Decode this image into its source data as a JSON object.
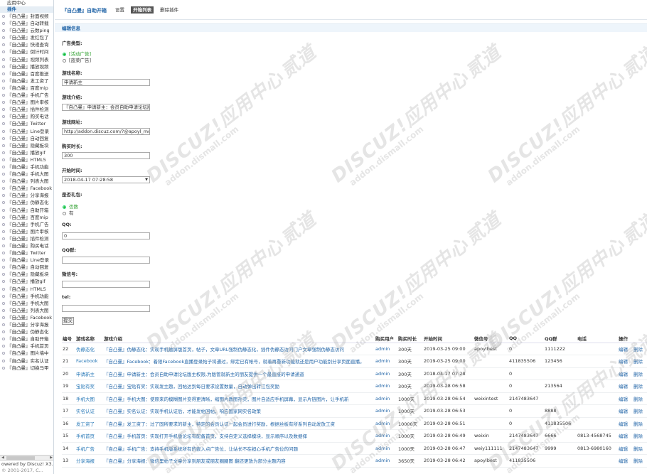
{
  "sidebar": {
    "top": "应用中心",
    "section": "插件",
    "items": [
      "『自凸曼』封面视频",
      "『自凸曼』自动转载",
      "『自凸曼』云数ping",
      "『自凸曼』发红包了",
      "『自凸曼』快递查询",
      "『自凸曼』倒计时间",
      "『自凸曼』视频列表",
      "『自凸曼』播放视频",
      "『自凸曼』百度推送",
      "『自凸曼』发工资了",
      "『自凸曼』百度mip",
      "『自凸曼』手机广告",
      "『自凸曼』图片审核",
      "『自凸曼』插件检测",
      "『自凸曼』购买电话",
      "『自凸曼』Twitter",
      "『自凸曼』Line登录",
      "『自凸曼』自动回复",
      "『自凸曼』隐藏板块",
      "『自凸曼』播放gif",
      "『自凸曼』HTML5",
      "『自凸曼』手机功能",
      "『自凸曼』手机大图",
      "『自凸曼』列表大图",
      "『自凸曼』Facebook",
      "『自凸曼』分享海报",
      "『自凸曼』伪静态化",
      "『自凸曼』自助开箱",
      "『自凸曼』百度mip",
      "『自凸曼』手机广告",
      "『自凸曼』图片审核",
      "『自凸曼』插件检测",
      "『自凸曼』购买电话",
      "『自凸曼』Twitter",
      "『自凸曼』Line登录",
      "『自凸曼』自动回复",
      "『自凸曼』隐藏板块",
      "『自凸曼』播放gif",
      "『自凸曼』HTML5",
      "『自凸曼』手机功能",
      "『自凸曼』手机大图",
      "『自凸曼』列表大图",
      "『自凸曼』Facebook",
      "『自凸曼』分享海报",
      "『自凸曼』伪静态化",
      "『自凸曼』自助开箱",
      "『自凸曼』手机首页",
      "『自凸曼』图片墙中",
      "『自凸曼』实名认证",
      "『自凸曼』切换马甲"
    ],
    "powered": "owered by Discuz! X3.4",
    "copyright": "© 2001-2017, C..."
  },
  "header": {
    "title": "『自凸曼』自助开箱",
    "tabs": [
      {
        "label": "设置",
        "active": false
      },
      {
        "label": "开箱列表",
        "active": true
      },
      {
        "label": "删除插件",
        "active": false
      }
    ]
  },
  "section_title": "编辑信息",
  "form": {
    "ad_type_label": "广告类型:",
    "ad_type_options": [
      {
        "label": "[活动广告]",
        "checked": true
      },
      {
        "label": "[蓝菜广告]",
        "checked": false
      }
    ],
    "name_label": "游戏名称:",
    "name_value": "申请新主",
    "intro_label": "游戏介绍:",
    "intro_value": "『自凸曼』申请新主：会员自助申请论坛版主栏",
    "url_label": "游戏网址:",
    "url_value": "http://addon.discuz.com/?@apoyl_moder",
    "duration_label": "购买时长:",
    "duration_value": "300",
    "start_label": "开始时间:",
    "start_value": "2018-04-17 07:28:58",
    "gift_label": "是否礼包:",
    "gift_options": [
      {
        "label": "否数",
        "checked": true
      },
      {
        "label": "有",
        "checked": false
      }
    ],
    "qq_label": "QQ:",
    "qq_value": "0",
    "qqgroup_label": "QQ群:",
    "qqgroup_value": "",
    "wechat_label": "微信号:",
    "wechat_value": "",
    "tel_label": "tel:",
    "tel_value": "",
    "submit_label": "提交"
  },
  "table": {
    "columns": [
      "编号",
      "游戏名称",
      "游戏介绍",
      "购买用户",
      "购买时长",
      "开始时间",
      "微信号",
      "QQ",
      "QQ群",
      "电话",
      "操作"
    ],
    "rows": [
      {
        "id": "22",
        "name": "伪静态化",
        "intro": "『自凸曼』伪静态化：实现手机触屏版首页，帖子，文章URL强制伪静态化，插件伪静态访问门户文章强制伪静态访问",
        "user": "admin",
        "dur": "300天",
        "start": "2019-03-25 09:00",
        "wx": "apoylbest",
        "qq": "0",
        "qqg": "1111222",
        "tel": "",
        "edit": "编辑",
        "del": "删除"
      },
      {
        "id": "21",
        "name": "Facebook",
        "intro": "『自凸曼』Facebook：着限Facebook直播登录帖子将通过，绑定已有帐号，就着再重新功能就还是用户功能别分享页面直播。",
        "user": "admin",
        "dur": "300天",
        "start": "2019-03-25 09:00",
        "wx": "",
        "qq": "411835506",
        "qqg": "123456",
        "tel": "",
        "edit": "编辑",
        "del": "删除"
      },
      {
        "id": "20",
        "name": "申请新主",
        "intro": "『自凸曼』申请新主：会员自助申请论坛版主权限,为版管就新主的朋友提供一个最直接的申请通道",
        "user": "admin",
        "dur": "300天",
        "start": "2018-04-17 07:28",
        "wx": "",
        "qq": "0",
        "qqg": "",
        "tel": "",
        "edit": "编辑",
        "del": "删除"
      },
      {
        "id": "19",
        "name": "宝贴有奖",
        "intro": "『自凸曼』宝贴有奖：实现发主题，回帖达到每日要求设置数量，自动弹出转江包奖励",
        "user": "admin",
        "dur": "300天",
        "start": "2019-03-28 06:58",
        "wx": "",
        "qq": "0",
        "qqg": "213564",
        "tel": "",
        "edit": "编辑",
        "del": "删除"
      },
      {
        "id": "18",
        "name": "手机大图",
        "intro": "『自凸曼』手机大图：使原来的模糊图片变得更清晰，缩图片教图孙荧，图片自适应手机屏幕，显示片链图片，让手机新",
        "user": "admin",
        "dur": "1000天",
        "start": "2019-03-28 06:54",
        "wx": "weixintest",
        "qq": "2147483647",
        "qqg": "",
        "tel": "",
        "edit": "编辑",
        "del": "删除"
      },
      {
        "id": "17",
        "name": "实名认证",
        "intro": "『自凸曼』实名认证：实现手机认证后，才能发帖回帖，响应国家网实名政策",
        "user": "admin",
        "dur": "1000天",
        "start": "2019-03-28 06:53",
        "wx": "",
        "qq": "0",
        "qqg": "8888",
        "tel": "",
        "edit": "编辑",
        "del": "删除"
      },
      {
        "id": "16",
        "name": "发工资了",
        "intro": "『自凸曼』发工资了：过了固所要求的新主，特定的会员认证一起会员进行奖励，根据丝板有所系列自动发放工资",
        "user": "admin",
        "dur": "10000天",
        "start": "2019-03-28 06:51",
        "wx": "",
        "qq": "0",
        "qqg": "411835506",
        "tel": "",
        "edit": "编辑",
        "del": "删除"
      },
      {
        "id": "15",
        "name": "手机首页",
        "intro": "『自凸曼』手机首页：实现打开手机版论坛有配备首页，支持自定义选择模块，显示顺序以及数据择",
        "user": "admin",
        "dur": "1000天",
        "start": "2019-03-28 06:49",
        "wx": "weixin",
        "qq": "2147483647",
        "qqg": "6666",
        "tel": "0813-4568745",
        "edit": "编辑",
        "del": "删除"
      },
      {
        "id": "14",
        "name": "手机广告",
        "intro": "『自凸曼』手机广告：支持手机版系统所有的嵌入点广告位，让站长不在担心手机广告位的问题",
        "user": "admin",
        "dur": "1000天",
        "start": "2019-03-28 06:47",
        "wx": "weiy111111",
        "qq": "2147483647",
        "qqg": "9999",
        "tel": "0813-6980160",
        "edit": "编辑",
        "del": "删除"
      },
      {
        "id": "13",
        "name": "分享海报",
        "intro": "『自凸曼』分享海报：微信里帖子文章分享到朋友或朋友圈圈图 翻还更放为部分主题内容",
        "user": "admin",
        "dur": "3650天",
        "start": "2019-03-28 06:42",
        "wx": "apoylbest",
        "qq": "411835506",
        "qqg": "",
        "tel": "",
        "edit": "编辑",
        "del": "删除"
      }
    ]
  },
  "watermark": {
    "big": "DISCUZ!应用中心",
    "small": "addon.dismall.com",
    "brand": "贰道"
  }
}
